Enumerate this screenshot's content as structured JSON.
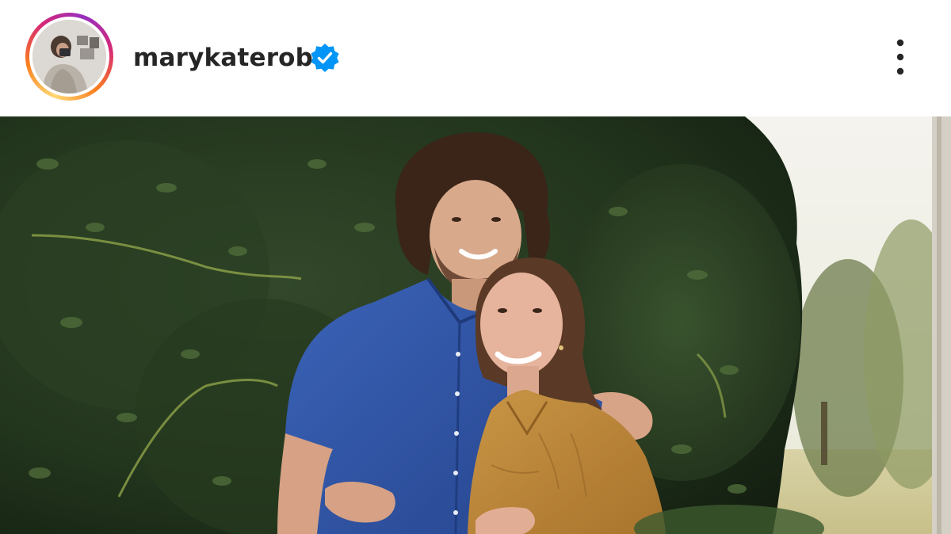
{
  "post_header": {
    "username": "marykaterob",
    "verified": true,
    "avatar_description": "profile photo",
    "more_options_icon": "more-vertical-icon",
    "verified_icon": "verified-badge-icon"
  },
  "colors": {
    "username": "#262626",
    "verified_badge": "#0095f6",
    "story_ring": [
      "#feda75",
      "#fa7e1e",
      "#d62976",
      "#962fbf"
    ]
  },
  "post_image": {
    "kind": "photo"
  }
}
